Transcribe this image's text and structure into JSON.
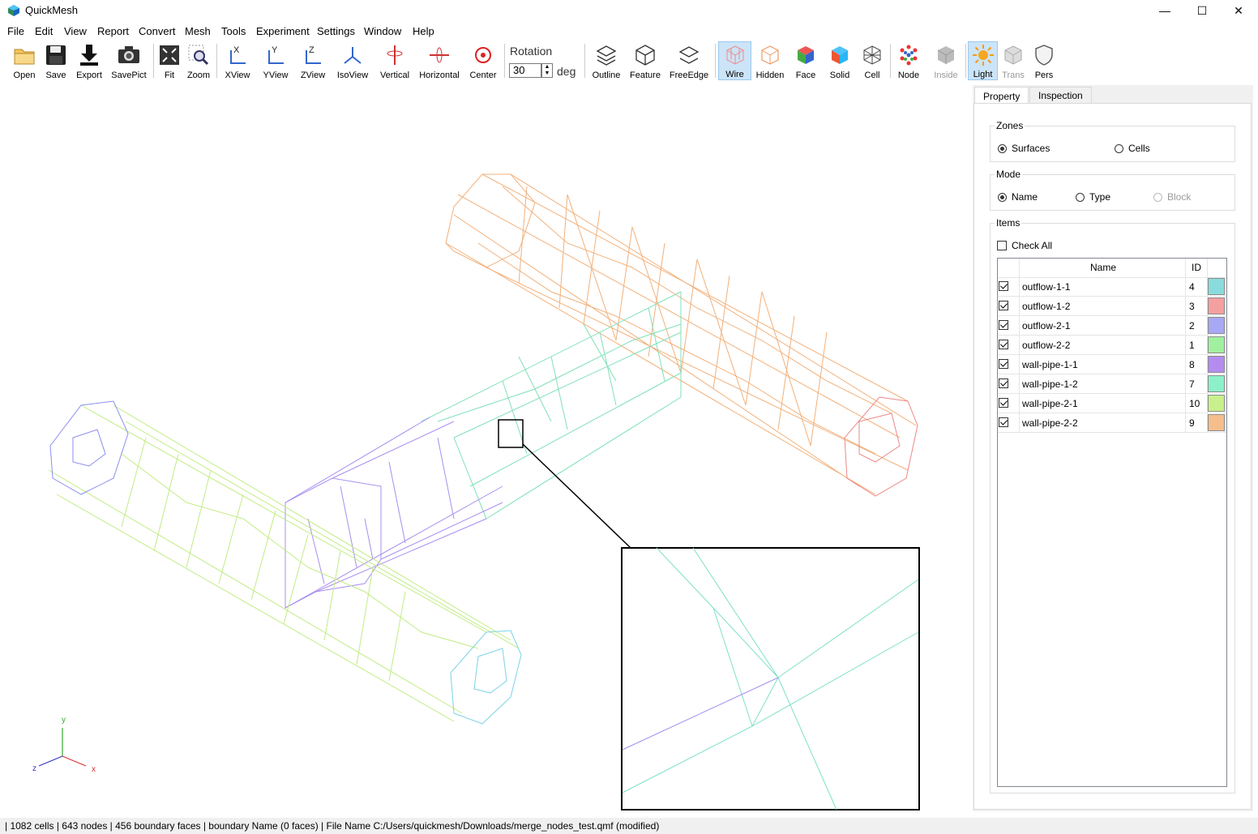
{
  "window": {
    "title": "QuickMesh",
    "minimize": "—",
    "maximize": "☐",
    "close": "✕"
  },
  "menu": [
    "File",
    "Edit",
    "View",
    "Report",
    "Convert",
    "Mesh",
    "Tools",
    "Experiment",
    "Settings",
    "Window",
    "Help"
  ],
  "toolbar": {
    "open": "Open",
    "save": "Save",
    "export": "Export",
    "savepict": "SavePict",
    "fit": "Fit",
    "zoom": "Zoom",
    "xview": "XView",
    "yview": "YView",
    "zview": "ZView",
    "isoview": "IsoView",
    "vertical": "Vertical",
    "horizontal": "Horizontal",
    "center": "Center",
    "rotation_label": "Rotation",
    "rotation_value": "30",
    "rotation_unit": "deg",
    "outline": "Outline",
    "feature": "Feature",
    "freeedge": "FreeEdge",
    "wire": "Wire",
    "hidden": "Hidden",
    "face": "Face",
    "solid": "Solid",
    "cell": "Cell",
    "node": "Node",
    "inside": "Inside",
    "light": "Light",
    "trans": "Trans",
    "pers": "Pers"
  },
  "axes": {
    "y": "y",
    "z": "z",
    "x": "x"
  },
  "panel": {
    "tabs": [
      "Property",
      "Inspection"
    ],
    "zones": {
      "title": "Zones",
      "surfaces": "Surfaces",
      "cells": "Cells",
      "selected": "Surfaces"
    },
    "mode": {
      "title": "Mode",
      "name": "Name",
      "type": "Type",
      "block": "Block",
      "selected": "Name"
    },
    "items": {
      "title": "Items",
      "check_all": "Check All",
      "col_name": "Name",
      "col_id": "ID",
      "rows": [
        {
          "name": "outflow-1-1",
          "id": "4",
          "color": "#8adcdc",
          "checked": true
        },
        {
          "name": "outflow-1-2",
          "id": "3",
          "color": "#f5a0a0",
          "checked": true
        },
        {
          "name": "outflow-2-1",
          "id": "2",
          "color": "#a8a8f5",
          "checked": true
        },
        {
          "name": "outflow-2-2",
          "id": "1",
          "color": "#a0f0a0",
          "checked": true
        },
        {
          "name": "wall-pipe-1-1",
          "id": "8",
          "color": "#b48cf0",
          "checked": true
        },
        {
          "name": "wall-pipe-1-2",
          "id": "7",
          "color": "#8cf0c8",
          "checked": true
        },
        {
          "name": "wall-pipe-2-1",
          "id": "10",
          "color": "#c8f08c",
          "checked": true
        },
        {
          "name": "wall-pipe-2-2",
          "id": "9",
          "color": "#f5be8c",
          "checked": true
        }
      ]
    }
  },
  "status": "| 1082 cells | 643 nodes | 456 boundary faces |  boundary Name  (0 faces) | File Name C:/Users/quickmesh/Downloads/merge_nodes_test.qmf (modified)"
}
